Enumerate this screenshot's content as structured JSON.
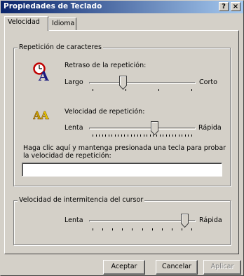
{
  "window": {
    "title": "Propiedades de Teclado",
    "help_glyph": "?",
    "close_glyph": "×"
  },
  "tabs": [
    {
      "label": "Velocidad",
      "active": true
    },
    {
      "label": "Idioma",
      "active": false
    }
  ],
  "repeat_group": {
    "legend": "Repetición de caracteres",
    "delay": {
      "label": "Retraso de la repetición:",
      "min_label": "Largo",
      "max_label": "Corto",
      "ticks": 4,
      "value_fraction": 0.33,
      "icon": "repeat-delay-icon"
    },
    "rate": {
      "label": "Velocidad de repetición:",
      "min_label": "Lenta",
      "max_label": "Rápida",
      "ticks": 32,
      "value_fraction": 0.59,
      "icon": "repeat-rate-icon"
    },
    "test_instructions": "Haga clic aquí y mantenga presionada una tecla para probar la velocidad de repetición:",
    "test_value": ""
  },
  "cursor_group": {
    "legend": "Velocidad de intermitencia del cursor",
    "blink": {
      "min_label": "Lenta",
      "max_label": "Rápida",
      "ticks": 11,
      "value_fraction": 0.9
    }
  },
  "buttons": {
    "ok": "Aceptar",
    "cancel": "Cancelar",
    "apply": "Aplicar"
  },
  "colors": {
    "titlebar_start": "#0a246a",
    "titlebar_end": "#a6caf0",
    "face": "#d4d0c8"
  }
}
